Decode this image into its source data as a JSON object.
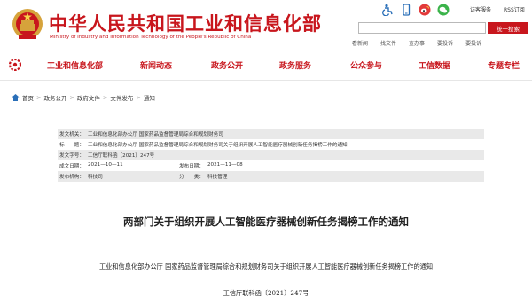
{
  "header": {
    "title": "中华人民共和国工业和信息化部",
    "subtitle": "Ministry of Industry and Information Technology of the People's Republic of China",
    "top_links": [
      "访客服务",
      "RSS订阅"
    ],
    "search_placeholder": "",
    "search_button": "统一搜索",
    "tool_links": [
      "看新闻",
      "找文件",
      "查办事",
      "要投诉",
      "要投诉"
    ],
    "icons": [
      "accessibility-icon",
      "mobile-icon",
      "weibo-icon",
      "wechat-icon"
    ],
    "brand_color": "#c8161d"
  },
  "nav": {
    "items": [
      "工业和信息化部",
      "新闻动态",
      "政务公开",
      "政务服务",
      "公众参与",
      "工信数据",
      "专题专栏"
    ]
  },
  "breadcrumb": [
    "首页",
    "政务公开",
    "政府文件",
    "文件发布",
    "通知"
  ],
  "info": {
    "issuer_label": "发文机关：",
    "issuer": "工业和信息化部办公厅  国家药品监督管理局综合和规划财务司",
    "title_label": "标　　题：",
    "title": "工业和信息化部办公厅 国家药品监督管理局综合和规划财务司关于组织开展人工智能医疗器械创新任务揭榜工作的通知",
    "doc_no_label": "发文字号：",
    "doc_no": "工信厅联科函〔2021〕247号",
    "date_label": "成文日期：",
    "date": "2021—10—11",
    "pub_date_label": "发布日期：",
    "pub_date": "2021—11—08",
    "org_label": "发布机构：",
    "org": "科技司",
    "cat_label": "分　　类：",
    "cat": "科技管理"
  },
  "document": {
    "heading": "两部门关于组织开展人工智能医疗器械创新任务揭榜工作的通知",
    "body_title": "工业和信息化部办公厅 国家药品监督管理局综合和规划财务司关于组织开展人工智能医疗器械创新任务揭榜工作的通知",
    "doc_number": "工信厅联科函〔2021〕247号"
  }
}
